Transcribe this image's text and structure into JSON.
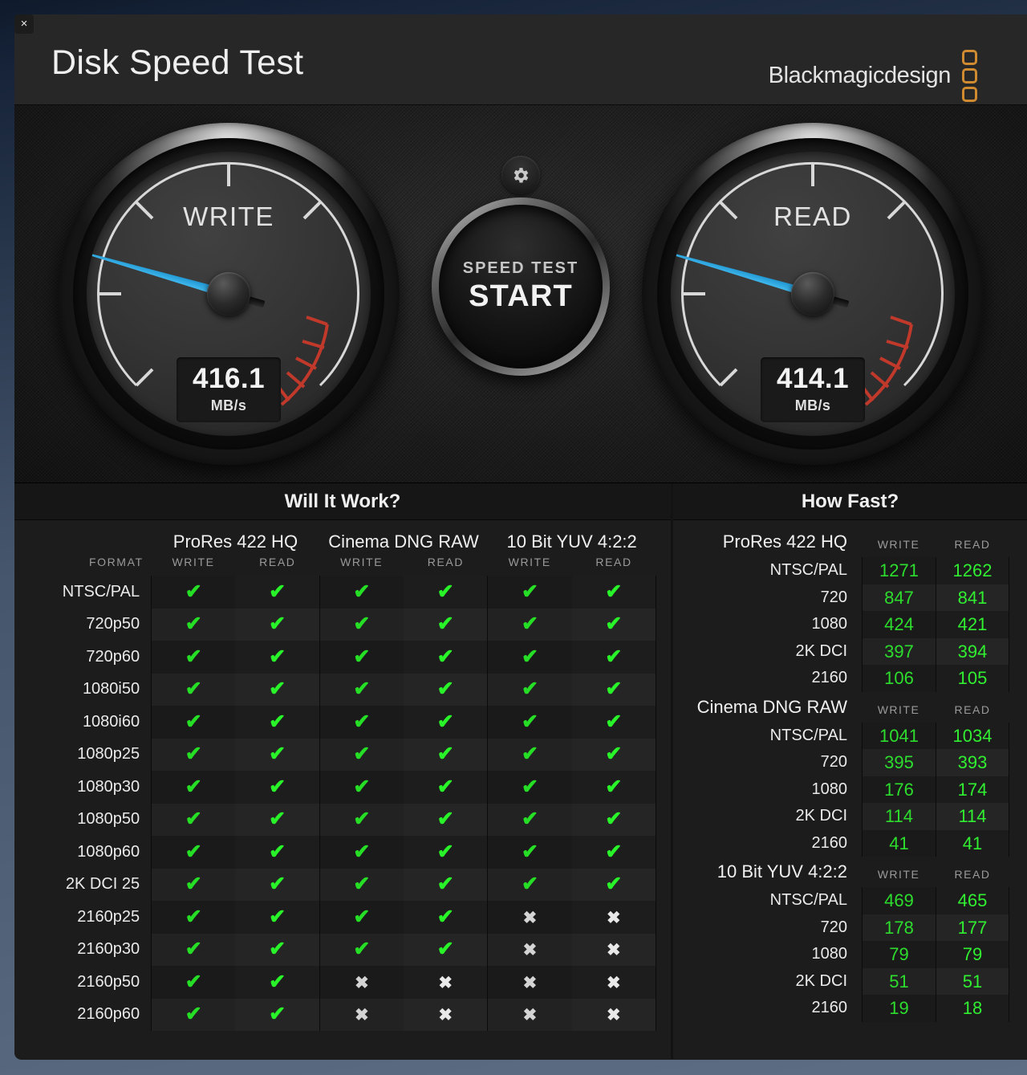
{
  "window": {
    "close_label": "×",
    "app_title": "Disk Speed Test",
    "brand": "Blackmagicdesign"
  },
  "gauges": {
    "write": {
      "label": "WRITE",
      "value": "416.1",
      "unit": "MB/s",
      "needle_deg": 196
    },
    "read": {
      "label": "READ",
      "value": "414.1",
      "unit": "MB/s",
      "needle_deg": 196
    }
  },
  "start_button": {
    "line1": "SPEED TEST",
    "line2": "START"
  },
  "gear_icon": "gear-icon",
  "will_it_work": {
    "title": "Will It Work?",
    "format_label": "FORMAT",
    "codecs": [
      "ProRes 422 HQ",
      "Cinema DNG RAW",
      "10 Bit YUV 4:2:2"
    ],
    "sub_columns": [
      "WRITE",
      "READ"
    ],
    "ok_glyph": "✔",
    "no_glyph": "✖",
    "rows": [
      {
        "format": "NTSC/PAL",
        "cells": [
          true,
          true,
          true,
          true,
          true,
          true
        ]
      },
      {
        "format": "720p50",
        "cells": [
          true,
          true,
          true,
          true,
          true,
          true
        ]
      },
      {
        "format": "720p60",
        "cells": [
          true,
          true,
          true,
          true,
          true,
          true
        ]
      },
      {
        "format": "1080i50",
        "cells": [
          true,
          true,
          true,
          true,
          true,
          true
        ]
      },
      {
        "format": "1080i60",
        "cells": [
          true,
          true,
          true,
          true,
          true,
          true
        ]
      },
      {
        "format": "1080p25",
        "cells": [
          true,
          true,
          true,
          true,
          true,
          true
        ]
      },
      {
        "format": "1080p30",
        "cells": [
          true,
          true,
          true,
          true,
          true,
          true
        ]
      },
      {
        "format": "1080p50",
        "cells": [
          true,
          true,
          true,
          true,
          true,
          true
        ]
      },
      {
        "format": "1080p60",
        "cells": [
          true,
          true,
          true,
          true,
          true,
          true
        ]
      },
      {
        "format": "2K DCI 25",
        "cells": [
          true,
          true,
          true,
          true,
          true,
          true
        ]
      },
      {
        "format": "2160p25",
        "cells": [
          true,
          true,
          true,
          true,
          false,
          false
        ]
      },
      {
        "format": "2160p30",
        "cells": [
          true,
          true,
          true,
          true,
          false,
          false
        ]
      },
      {
        "format": "2160p50",
        "cells": [
          true,
          true,
          false,
          false,
          false,
          false
        ]
      },
      {
        "format": "2160p60",
        "cells": [
          true,
          true,
          false,
          false,
          false,
          false
        ]
      }
    ]
  },
  "how_fast": {
    "title": "How Fast?",
    "col_write": "WRITE",
    "col_read": "READ",
    "groups": [
      {
        "codec": "ProRes 422 HQ",
        "rows": [
          {
            "res": "NTSC/PAL",
            "write": "1271",
            "read": "1262"
          },
          {
            "res": "720",
            "write": "847",
            "read": "841"
          },
          {
            "res": "1080",
            "write": "424",
            "read": "421"
          },
          {
            "res": "2K DCI",
            "write": "397",
            "read": "394"
          },
          {
            "res": "2160",
            "write": "106",
            "read": "105"
          }
        ]
      },
      {
        "codec": "Cinema DNG RAW",
        "rows": [
          {
            "res": "NTSC/PAL",
            "write": "1041",
            "read": "1034"
          },
          {
            "res": "720",
            "write": "395",
            "read": "393"
          },
          {
            "res": "1080",
            "write": "176",
            "read": "174"
          },
          {
            "res": "2K DCI",
            "write": "114",
            "read": "114"
          },
          {
            "res": "2160",
            "write": "41",
            "read": "41"
          }
        ]
      },
      {
        "codec": "10 Bit YUV 4:2:2",
        "rows": [
          {
            "res": "NTSC/PAL",
            "write": "469",
            "read": "465"
          },
          {
            "res": "720",
            "write": "178",
            "read": "177"
          },
          {
            "res": "1080",
            "write": "79",
            "read": "79"
          },
          {
            "res": "2K DCI",
            "write": "51",
            "read": "51"
          },
          {
            "res": "2160",
            "write": "19",
            "read": "18"
          }
        ]
      }
    ]
  },
  "colors": {
    "accent_blue": "#29a9e0",
    "ok_green": "#25de25",
    "value_green": "#2ddd2d",
    "brand_orange": "#d08a30",
    "red_zone": "#c0392b"
  }
}
